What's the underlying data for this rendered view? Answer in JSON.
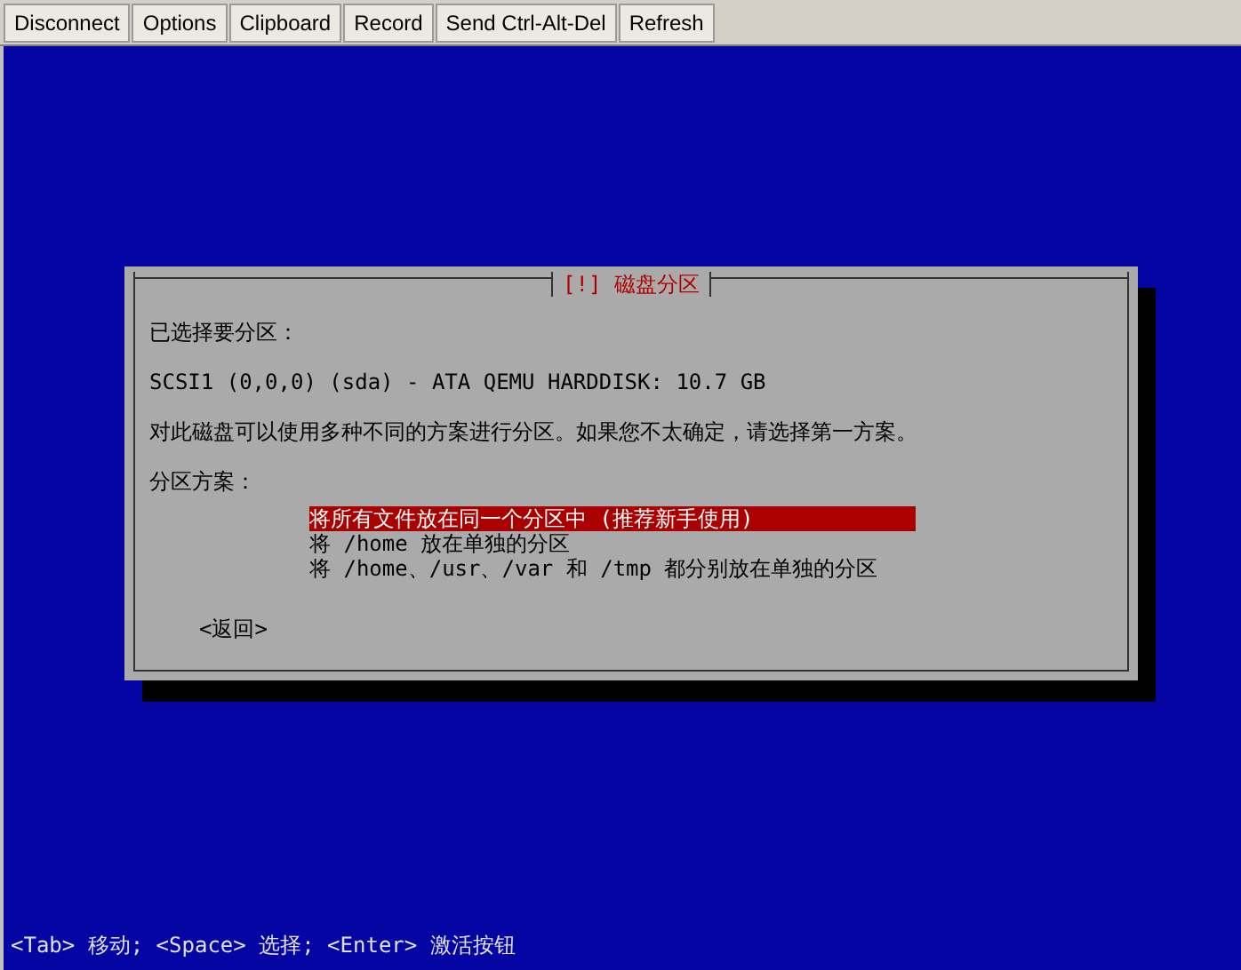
{
  "toolbar": {
    "buttons": [
      "Disconnect",
      "Options",
      "Clipboard",
      "Record",
      "Send Ctrl-Alt-Del",
      "Refresh"
    ]
  },
  "dialog": {
    "title": "[!] 磁盘分区",
    "paragraphs": [
      "已选择要分区：",
      "SCSI1 (0,0,0) (sda) - ATA QEMU HARDDISK: 10.7 GB",
      "对此磁盘可以使用多种不同的方案进行分区。如果您不太确定，请选择第一方案。",
      "分区方案："
    ],
    "options": [
      {
        "label": "将所有文件放在同一个分区中 (推荐新手使用)",
        "selected": true
      },
      {
        "label": "将 /home 放在单独的分区",
        "selected": false
      },
      {
        "label": "将 /home、/usr、/var 和 /tmp 都分别放在单独的分区",
        "selected": false
      }
    ],
    "back_button": "<返回>"
  },
  "help_line": "<Tab> 移动; <Space> 选择; <Enter> 激活按钮"
}
